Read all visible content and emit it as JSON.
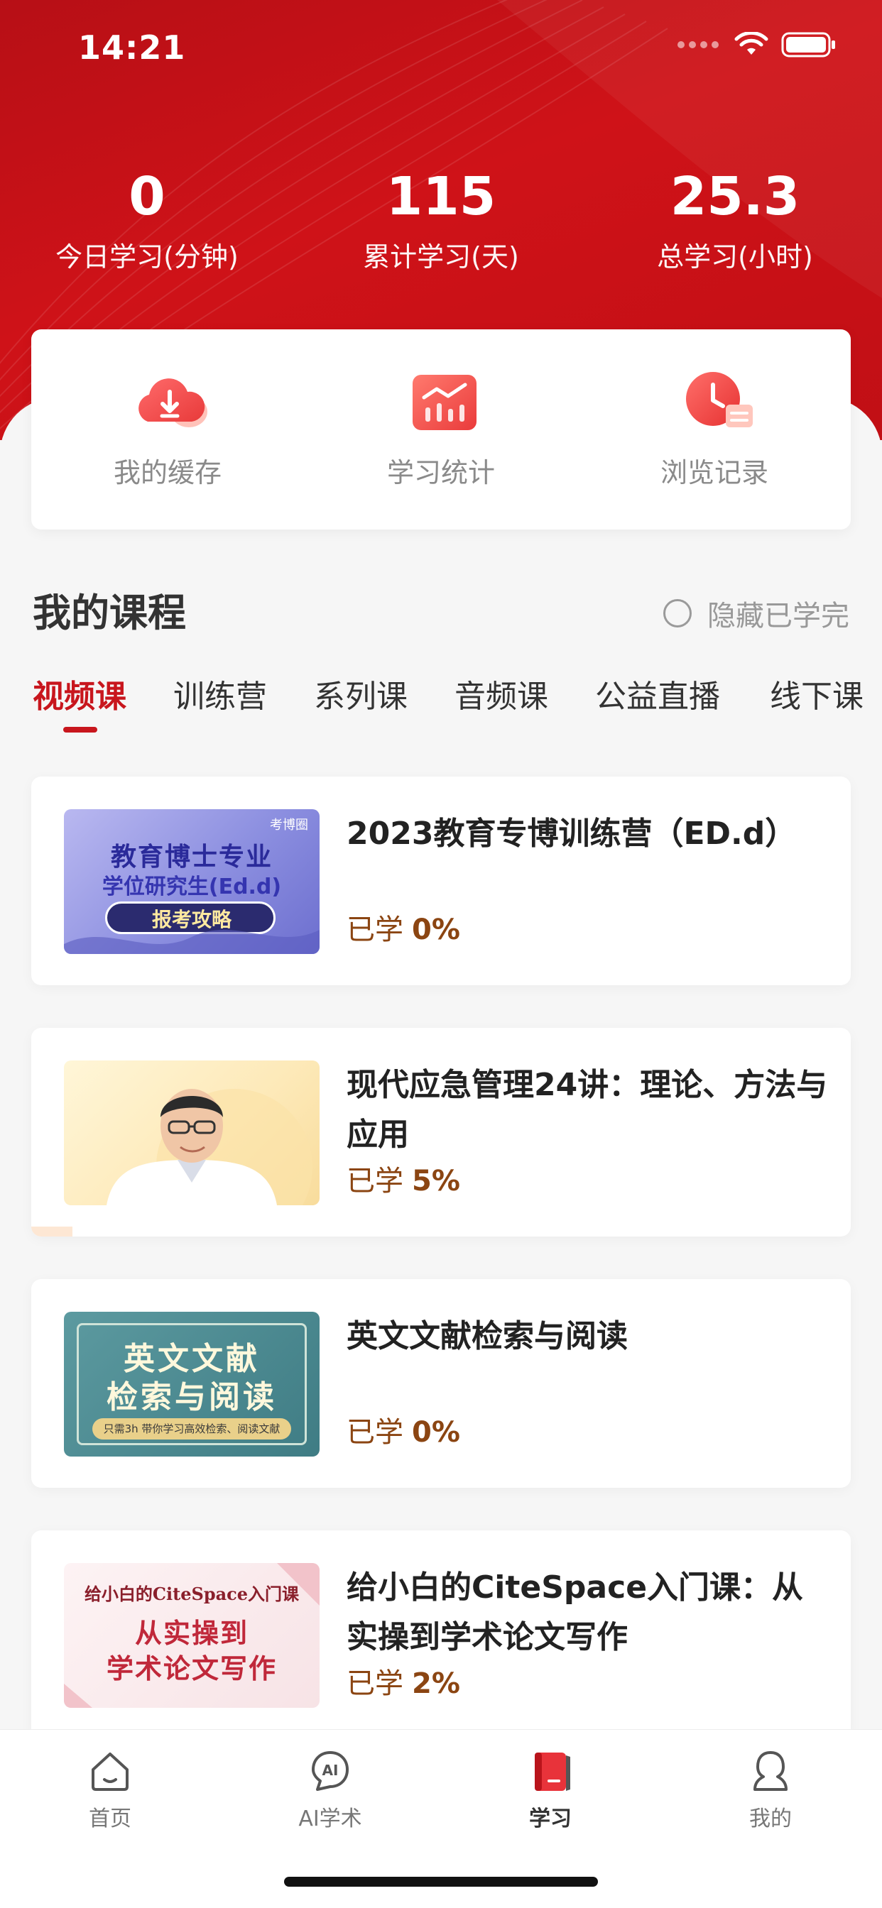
{
  "status_bar": {
    "time": "14:21"
  },
  "stats": [
    {
      "value": "0",
      "label": "今日学习(分钟)"
    },
    {
      "value": "115",
      "label": "累计学习(天)"
    },
    {
      "value": "25.3",
      "label": "总学习(小时)"
    }
  ],
  "quick_actions": [
    {
      "label": "我的缓存",
      "icon": "cloud-download-icon"
    },
    {
      "label": "学习统计",
      "icon": "bar-chart-icon"
    },
    {
      "label": "浏览记录",
      "icon": "clock-history-icon"
    }
  ],
  "section": {
    "title": "我的课程",
    "hide_completed": "隐藏已学完"
  },
  "tabs": [
    "视频课",
    "训练营",
    "系列课",
    "音频课",
    "公益直播",
    "线下课"
  ],
  "active_tab": "视频课",
  "progress_prefix": "已学",
  "courses": [
    {
      "title": "2023教育专博训练营（ED.d）",
      "progress": "0%",
      "thumb": {
        "brand": "考博圈",
        "line1": "教育博士专业",
        "line2": "学位研究生(Ed.d)",
        "line3": "报考攻略"
      }
    },
    {
      "title": "现代应急管理24讲：理论、方法与应用",
      "progress": "5%",
      "thumb": {}
    },
    {
      "title": "英文文献检索与阅读",
      "progress": "0%",
      "thumb": {
        "line1": "英文文献",
        "line2": "检索与阅读",
        "line3": "只需3h 带你学习高效检索、阅读文献"
      }
    },
    {
      "title": "给小白的CiteSpace入门课：从实操到学术论文写作",
      "progress": "2%",
      "thumb": {
        "line1": "给小白的CiteSpace入门课",
        "line2": "从实操到",
        "line3": "学术论文写作"
      }
    }
  ],
  "tabbar": [
    {
      "label": "首页",
      "icon": "home-icon"
    },
    {
      "label": "AI学术",
      "icon": "ai-icon"
    },
    {
      "label": "学习",
      "icon": "book-icon"
    },
    {
      "label": "我的",
      "icon": "profile-icon"
    }
  ],
  "active_tabbar": "学习",
  "colors": {
    "brand_red": "#c8161d",
    "progress_brown": "#8b4512"
  }
}
